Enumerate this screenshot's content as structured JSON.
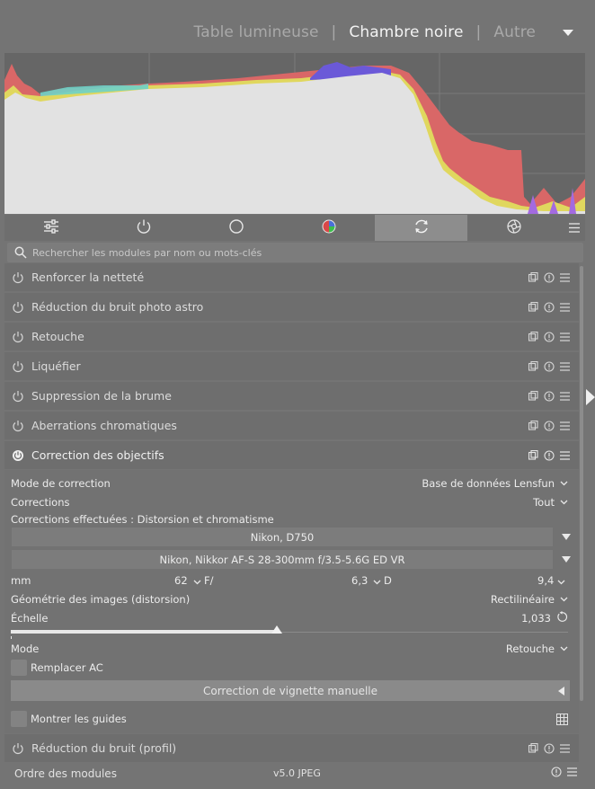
{
  "header": {
    "views": [
      {
        "label": "Table lumineuse",
        "active": false
      },
      {
        "label": "Chambre noire",
        "active": true
      },
      {
        "label": "Autre",
        "active": false
      }
    ],
    "separator": "|"
  },
  "group_tabs": {
    "icons": [
      "sliders-icon",
      "power-icon",
      "circle-icon",
      "color-wheel-icon",
      "refresh-icon",
      "aperture-icon"
    ],
    "active_index": 4
  },
  "search": {
    "placeholder": "Rechercher les modules par nom ou mots-clés"
  },
  "modules": [
    {
      "name": "Renforcer la netteté"
    },
    {
      "name": "Réduction du bruit photo astro"
    },
    {
      "name": "Retouche"
    },
    {
      "name": "Liquéfier"
    },
    {
      "name": "Suppression de la brume"
    },
    {
      "name": "Aberrations chromatiques"
    },
    {
      "name": "Correction des objectifs"
    }
  ],
  "lens_panel": {
    "mode_label": "Mode de correction",
    "mode_value": "Base de données Lensfun",
    "corrections_label": "Corrections",
    "corrections_value": "Tout",
    "applied_text": "Corrections effectuées : Distorsion et chromatisme",
    "camera": "Nikon, D750",
    "lens": "Nikon, Nikkor AF-S 28-300mm f/3.5-5.6G ED VR",
    "focal_unit": "mm",
    "focal_value": "62",
    "aperture_label": "F/",
    "aperture_value": "6,3",
    "distance_label": "D",
    "distance_value": "9,4",
    "geometry_label": "Géométrie des images (distorsion)",
    "geometry_value": "Rectilinéaire",
    "scale_label": "Échelle",
    "scale_value": "1,033",
    "scale_fraction": 0.47,
    "mode2_label": "Mode",
    "mode2_value": "Retouche",
    "replace_ac_label": "Remplacer AC",
    "vignette_button": "Correction de vignette manuelle",
    "show_guides_label": "Montrer les guides"
  },
  "last_module": {
    "name": "Réduction du bruit (profil)"
  },
  "footer": {
    "order_label": "Ordre des modules",
    "version": "v5.0 JPEG"
  }
}
